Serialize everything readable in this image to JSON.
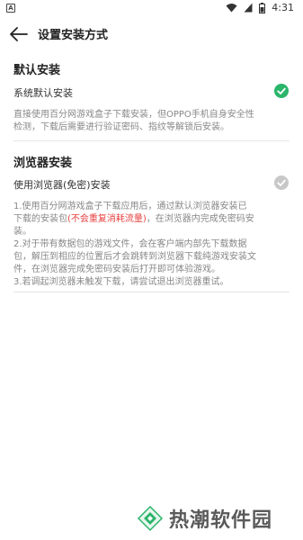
{
  "status": {
    "time": "4:31",
    "left_icon": "A"
  },
  "header": {
    "title": "设置安装方式"
  },
  "default_install": {
    "section_title": "默认安装",
    "option_label": "系统默认安装",
    "selected": true,
    "description_line1": "直接使用百分网游戏盒子下载安装，但OPPO手机自身安全性",
    "description_line2": "检测，下载后需要进行验证密码、指纹等解锁后安装。"
  },
  "browser_install": {
    "section_title": "浏览器安装",
    "option_label": "使用浏览器(免密)安装",
    "selected": false,
    "desc": {
      "l1": "1.使用百分网游戏盒子下载应用后，通过默认浏览器安装已",
      "l2_pre": "下载的安装包",
      "l2_warn": "(不会重复消耗流量)",
      "l2_post": "，在浏览器内完成免密码安",
      "l3": "装。",
      "l4": "2.对于带有数据包的游戏文件，会在客户端内部先下载数据",
      "l5": "包，解压到相应的位置后才会跳转到浏览器下载纯游戏安装文",
      "l6": "件，在浏览器完成免密码安装后打开即可体验游戏。",
      "l7": "3.若调起浏览器未触发下载，请尝试退出浏览器重试。"
    }
  },
  "colors": {
    "accent_green": "#2bb56b",
    "inactive_gray": "#c8c8c8",
    "warning_red": "#e84040"
  },
  "watermark": {
    "text": "热潮软件园"
  }
}
